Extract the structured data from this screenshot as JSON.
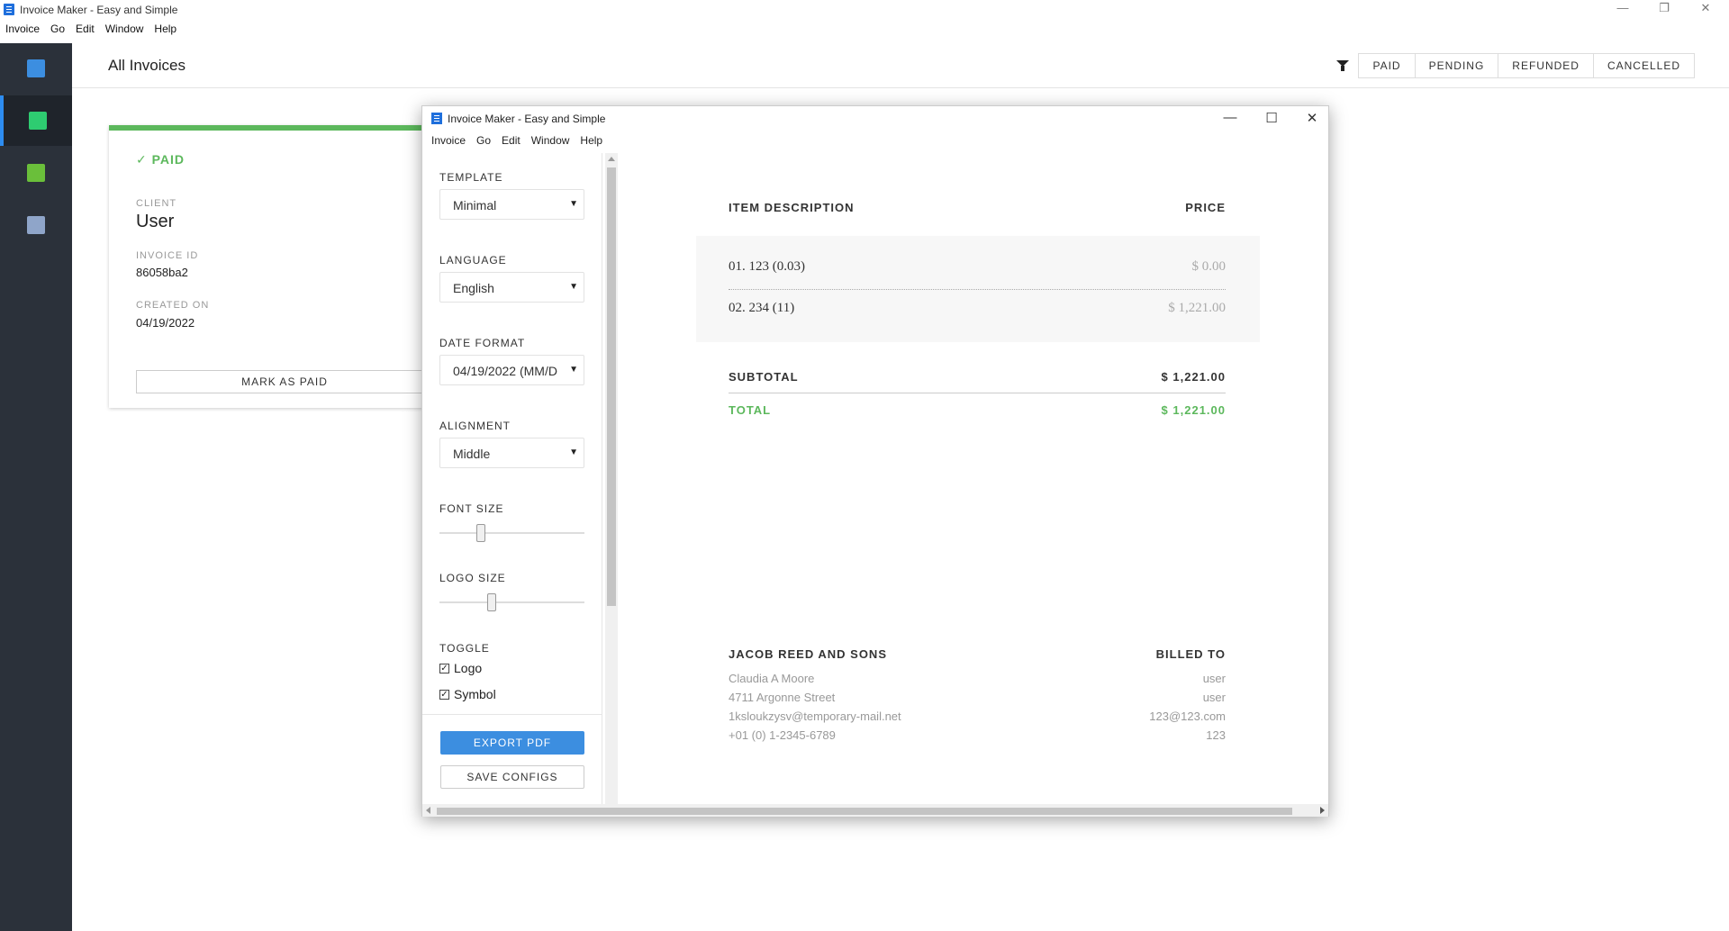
{
  "window": {
    "title": "Invoice Maker - Easy and Simple"
  },
  "menu": [
    "Invoice",
    "Go",
    "Edit",
    "Window",
    "Help"
  ],
  "window_controls": {
    "minimize": "—",
    "restore": "❐",
    "close": "✕"
  },
  "sidebar": {
    "items": [
      "new-invoice-icon",
      "invoices-icon",
      "contacts-icon",
      "settings-icon"
    ],
    "active": 1
  },
  "header": {
    "title": "All Invoices",
    "filters": [
      "PAID",
      "PENDING",
      "REFUNDED",
      "CANCELLED"
    ]
  },
  "card": {
    "status": "✓ PAID",
    "client_label": "CLIENT",
    "client": "User",
    "id_label": "INVOICE ID",
    "id": "86058ba2",
    "created_label": "CREATED ON",
    "created": "04/19/2022",
    "mark_button": "MARK AS PAID"
  },
  "dialog": {
    "title": "Invoice Maker - Easy and Simple",
    "menu": [
      "Invoice",
      "Go",
      "Edit",
      "Window",
      "Help"
    ],
    "controls": {
      "minimize": "—",
      "maximize": "☐",
      "close": "✕"
    },
    "settings": {
      "template_label": "TEMPLATE",
      "template": "Minimal",
      "language_label": "LANGUAGE",
      "language": "English",
      "date_label": "DATE FORMAT",
      "date": "04/19/2022 (MM/D",
      "alignment_label": "ALIGNMENT",
      "alignment": "Middle",
      "font_label": "FONT SIZE",
      "font_level": 0.27,
      "logo_label": "LOGO SIZE",
      "logo_level": 0.35,
      "toggle_label": "TOGGLE",
      "toggles": [
        {
          "label": "Logo",
          "checked": true
        },
        {
          "label": "Symbol",
          "checked": true
        }
      ],
      "export": "EXPORT PDF",
      "save": "SAVE CONFIGS"
    },
    "invoice": {
      "col_desc": "ITEM DESCRIPTION",
      "col_price": "PRICE",
      "items": [
        {
          "desc": "01. 123 (0.03)",
          "price": "$ 0.00"
        },
        {
          "desc": "02. 234 (11)",
          "price": "$ 1,221.00"
        }
      ],
      "subtotal_label": "SUBTOTAL",
      "subtotal": "$ 1,221.00",
      "total_label": "TOTAL",
      "total": "$ 1,221.00",
      "from": {
        "name": "JACOB REED AND SONS",
        "lines": [
          "Claudia A Moore",
          "4711 Argonne Street",
          "1ksloukzysv@temporary-mail.net",
          "+01 (0) 1-2345-6789"
        ]
      },
      "to": {
        "label": "BILLED TO",
        "lines": [
          "user",
          "user",
          "123@123.com",
          "123"
        ]
      }
    }
  },
  "colors": {
    "accent": "#3c8ee0",
    "paid": "#5cb85c",
    "sidebar": "#2b313a"
  }
}
